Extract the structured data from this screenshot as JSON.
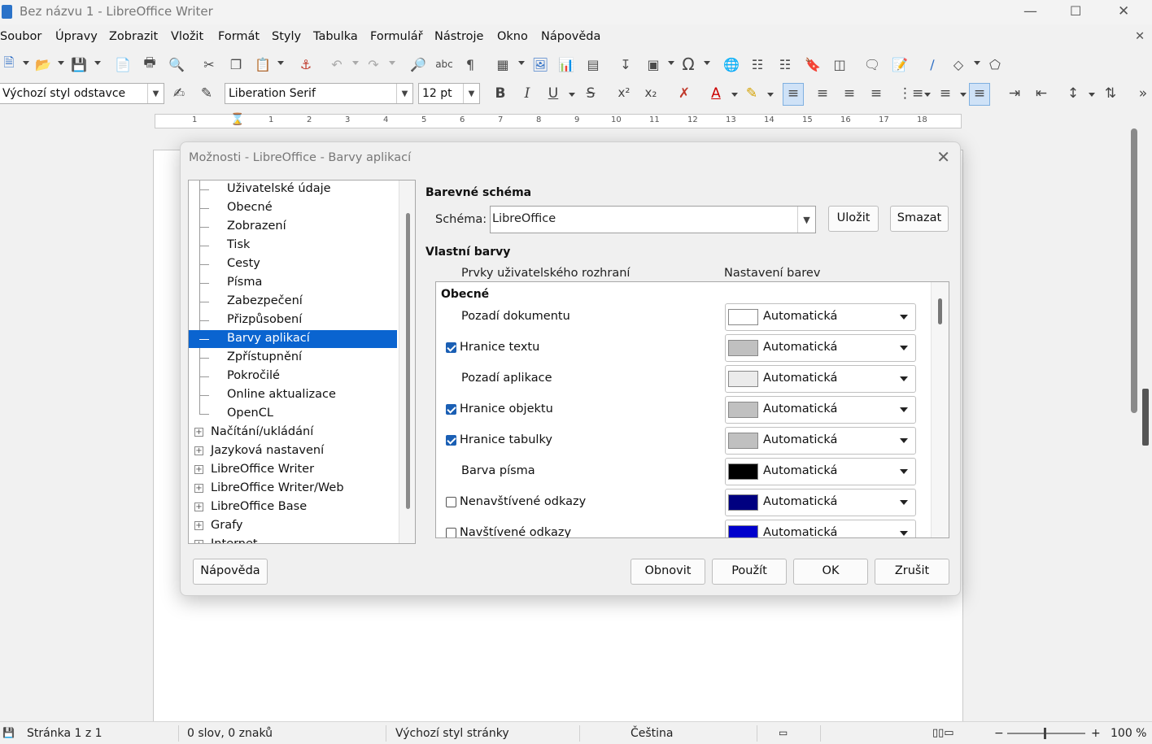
{
  "window": {
    "title": "Bez názvu 1 - LibreOffice Writer"
  },
  "menu": [
    "Soubor",
    "Úpravy",
    "Zobrazit",
    "Vložit",
    "Formát",
    "Styly",
    "Tabulka",
    "Formulář",
    "Nástroje",
    "Okno",
    "Nápověda"
  ],
  "formatting": {
    "paragraph_style": "Výchozí styl odstavce",
    "font_name": "Liberation Serif",
    "font_size": "12 pt",
    "bold": "B",
    "italic": "I",
    "underline": "U",
    "strike": "S"
  },
  "ruler": {
    "numbers": [
      "1",
      "1",
      "2",
      "3",
      "4",
      "5",
      "6",
      "7",
      "8",
      "9",
      "10",
      "11",
      "12",
      "13",
      "14",
      "15",
      "16",
      "17",
      "18"
    ]
  },
  "dialog": {
    "title": "Možnosti - LibreOffice - Barvy aplikací",
    "tree": {
      "children": [
        "Uživatelské údaje",
        "Obecné",
        "Zobrazení",
        "Tisk",
        "Cesty",
        "Písma",
        "Zabezpečení",
        "Přizpůsobení",
        "Barvy aplikací",
        "Zpřístupnění",
        "Pokročilé",
        "Online aktualizace",
        "OpenCL"
      ],
      "selected": "Barvy aplikací",
      "groups": [
        "Načítání/ukládání",
        "Jazyková nastavení",
        "LibreOffice Writer",
        "LibreOffice Writer/Web",
        "LibreOffice Base",
        "Grafy",
        "Internet"
      ]
    },
    "scheme": {
      "heading": "Barevné schéma",
      "label": "Schéma:",
      "value": "LibreOffice",
      "save_label": "Uložit",
      "delete_label": "Smazat"
    },
    "custom": {
      "heading": "Vlastní barvy",
      "col_elements": "Prvky uživatelského rozhraní",
      "col_settings": "Nastavení barev",
      "group_label": "Obecné",
      "rows": [
        {
          "label": "Pozadí dokumentu",
          "checkbox": false,
          "checked": false,
          "value": "Automatická",
          "swatch": "#ffffff"
        },
        {
          "label": "Hranice textu",
          "checkbox": true,
          "checked": true,
          "value": "Automatická",
          "swatch": "#c0c0c0"
        },
        {
          "label": "Pozadí aplikace",
          "checkbox": false,
          "checked": false,
          "value": "Automatická",
          "swatch": "#ebebeb"
        },
        {
          "label": "Hranice objektu",
          "checkbox": true,
          "checked": true,
          "value": "Automatická",
          "swatch": "#c0c0c0"
        },
        {
          "label": "Hranice tabulky",
          "checkbox": true,
          "checked": true,
          "value": "Automatická",
          "swatch": "#c0c0c0"
        },
        {
          "label": "Barva písma",
          "checkbox": false,
          "checked": false,
          "value": "Automatická",
          "swatch": "#000000"
        },
        {
          "label": "Nenavštívené odkazy",
          "checkbox": true,
          "checked": false,
          "value": "Automatická",
          "swatch": "#000080"
        },
        {
          "label": "Navštívené odkazy",
          "checkbox": true,
          "checked": false,
          "value": "Automatická",
          "swatch": "#0000cc"
        }
      ]
    },
    "buttons": {
      "help": "Nápověda",
      "reset": "Obnovit",
      "apply": "Použít",
      "ok": "OK",
      "cancel": "Zrušit"
    }
  },
  "status": {
    "page": "Stránka 1 z 1",
    "words": "0 slov, 0 znaků",
    "page_style": "Výchozí styl stránky",
    "language": "Čeština",
    "zoom": "100 %"
  },
  "colors": {
    "accent": "#0a64d0",
    "checkbox": "#1a5fb4"
  }
}
